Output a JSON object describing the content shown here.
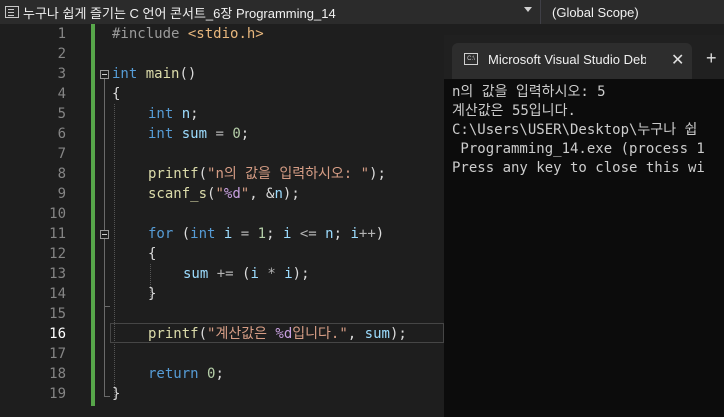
{
  "topbar": {
    "project": "누구나 쉽게 즐기는 C 언어 콘서트_6장 Programming_14",
    "scope": "(Global Scope)"
  },
  "editor": {
    "current_line": 16,
    "line_numbers": [
      "1",
      "2",
      "3",
      "4",
      "5",
      "6",
      "7",
      "8",
      "9",
      "10",
      "11",
      "12",
      "13",
      "14",
      "15",
      "16",
      "17",
      "18",
      "19"
    ]
  },
  "code": {
    "l1_directive": "#include",
    "l1_header": "<stdio.h>",
    "l3_type": "int",
    "l3_name": "main",
    "l3_parens": "()",
    "l4_brace": "{",
    "l6_type": "int",
    "l6_var": "n",
    "l6_semi": ";",
    "l7_type": "int",
    "l7_var": "sum",
    "l7_eq": "=",
    "l7_val": "0",
    "l7_semi": ";",
    "l9_fn": "printf",
    "l9_open": "(",
    "l9_str": "\"n의 값을 입력하시오: \"",
    "l9_close": ");",
    "l10_fn": "scanf_s",
    "l10_open": "(",
    "l10_q1": "\"",
    "l10_fmt": "%d",
    "l10_q2": "\"",
    "l10_comma": ", &",
    "l10_var": "n",
    "l10_close": ");",
    "l12_kw": "for",
    "l12_open": "(",
    "l12_type": "int",
    "l12_i1": "i",
    "l12_eq": "=",
    "l12_one": "1",
    "l12_semi1": ";",
    "l12_i2": "i",
    "l12_le": "<=",
    "l12_n": "n",
    "l12_semi2": ";",
    "l12_i3": "i",
    "l12_inc": "++",
    "l12_close": ")",
    "l13_brace": "{",
    "l14_sum": "sum",
    "l14_op": "+=",
    "l14_open": "(",
    "l14_i1": "i",
    "l14_mul": "*",
    "l14_i2": "i",
    "l14_close": ");",
    "l15_brace": "}",
    "l17_fn": "printf",
    "l17_open": "(",
    "l17_str1": "\"계산값은 ",
    "l17_fmt": "%d",
    "l17_str2": "입니다.\"",
    "l17_comma": ",",
    "l17_var": "sum",
    "l17_close": ");",
    "l19_kw": "return",
    "l19_val": "0",
    "l19_semi": ";",
    "l20_brace": "}"
  },
  "console": {
    "tab_title": "Microsoft Visual Studio Debug",
    "tab_close": "✕",
    "new_tab": "+",
    "icon_text": "C:\\",
    "lines": [
      "n의 값을 입력하시오: 5",
      "계산값은 55입니다.",
      "C:\\Users\\USER\\Desktop\\누구나 쉽",
      " Programming_14.exe (process 1",
      "Press any key to close this wi"
    ]
  },
  "colors": {
    "keyword": "#569cd6",
    "function": "#dcdcaa",
    "variable": "#9cdcfe",
    "string": "#d69d85",
    "number": "#b5cea8",
    "change_bar": "#57a64a"
  }
}
